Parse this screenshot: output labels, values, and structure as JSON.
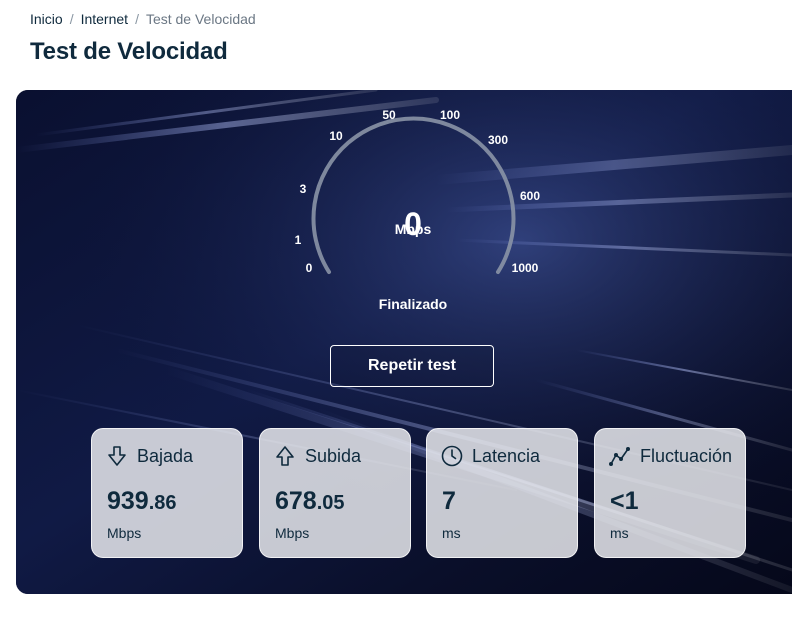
{
  "breadcrumb": {
    "items": [
      "Inicio",
      "Internet"
    ],
    "current": "Test de Velocidad",
    "separator": "/"
  },
  "page_title": "Test de Velocidad",
  "gauge": {
    "value": "0",
    "unit": "Mbps",
    "scale_labels": [
      "0",
      "1",
      "3",
      "10",
      "50",
      "100",
      "300",
      "600",
      "1000"
    ],
    "status": "Finalizado"
  },
  "repeat_button": "Repetir test",
  "cards": [
    {
      "icon": "download-icon",
      "label": "Bajada",
      "value_int": "939",
      "value_dec": ".86",
      "unit": "Mbps"
    },
    {
      "icon": "upload-icon",
      "label": "Subida",
      "value_int": "678",
      "value_dec": ".05",
      "unit": "Mbps"
    },
    {
      "icon": "clock-icon",
      "label": "Latencia",
      "value_int": "7",
      "value_dec": "",
      "unit": "ms"
    },
    {
      "icon": "jitter-chart-icon",
      "label": "Fluctuación",
      "value_int": "<1",
      "value_dec": "",
      "unit": "ms"
    }
  ],
  "colors": {
    "text": "#0f2a3d",
    "hero_bg": "#080d22",
    "card_bg": "#e6e8ec"
  }
}
